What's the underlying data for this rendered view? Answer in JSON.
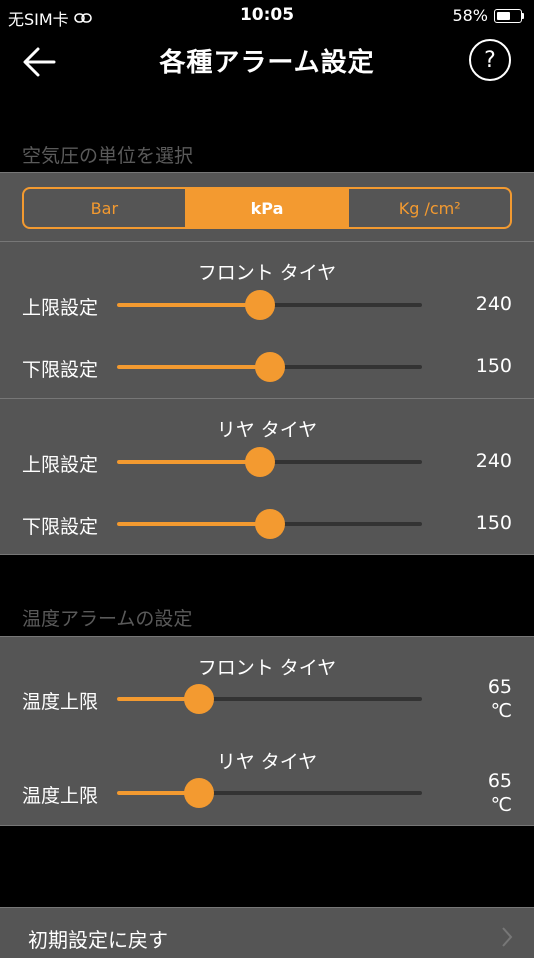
{
  "status_bar": {
    "carrier": "无SIM卡",
    "time": "10:05",
    "battery": "58%"
  },
  "nav": {
    "title": "各種アラーム設定",
    "help_label": "?"
  },
  "pressure": {
    "header": "空気圧の単位を選択",
    "units": [
      "Bar",
      "kPa",
      "Kg /cm²"
    ],
    "selected_unit": "kPa",
    "groups": [
      {
        "title": "フロント タイヤ",
        "rows": [
          {
            "label": "上限設定",
            "value": "240",
            "fraction": 0.47
          },
          {
            "label": "下限設定",
            "value": "150",
            "fraction": 0.5
          }
        ]
      },
      {
        "title": "リヤ タイヤ",
        "rows": [
          {
            "label": "上限設定",
            "value": "240",
            "fraction": 0.47
          },
          {
            "label": "下限設定",
            "value": "150",
            "fraction": 0.5
          }
        ]
      }
    ]
  },
  "temperature": {
    "header": "温度アラームの設定",
    "groups": [
      {
        "title": "フロント タイヤ",
        "rows": [
          {
            "label": "温度上限",
            "value": "65",
            "unit": "℃",
            "fraction": 0.27
          }
        ]
      },
      {
        "title": "リヤ タイヤ",
        "rows": [
          {
            "label": "温度上限",
            "value": "65",
            "unit": "℃",
            "fraction": 0.27
          }
        ]
      }
    ]
  },
  "reset": {
    "label": "初期設定に戻す"
  },
  "colors": {
    "accent": "#f39a30",
    "panel": "#555555",
    "background": "#000000"
  }
}
